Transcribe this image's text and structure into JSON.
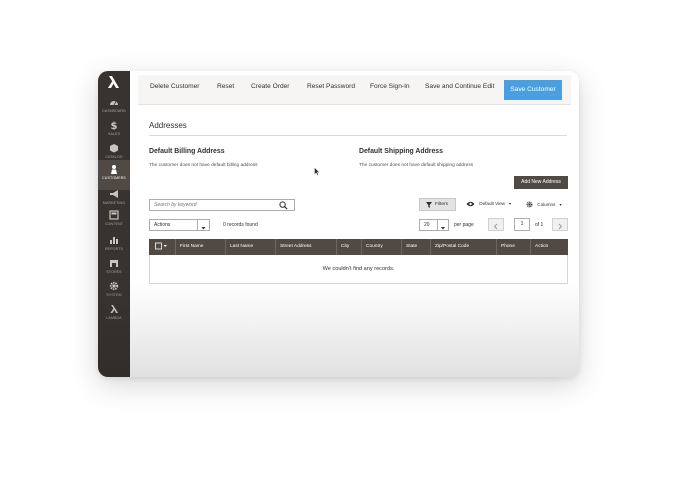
{
  "sidebar": {
    "items": [
      {
        "label": "Dashboard",
        "icon": "dashboard-icon"
      },
      {
        "label": "Sales",
        "icon": "dollar-icon"
      },
      {
        "label": "Catalog",
        "icon": "box-icon"
      },
      {
        "label": "Customers",
        "icon": "person-icon",
        "active": true
      },
      {
        "label": "Marketing",
        "icon": "megaphone-icon"
      },
      {
        "label": "Content",
        "icon": "layout-icon"
      },
      {
        "label": "Reports",
        "icon": "bar-chart-icon"
      },
      {
        "label": "Stores",
        "icon": "store-icon"
      },
      {
        "label": "System",
        "icon": "gear-icon"
      },
      {
        "label": "Lambda",
        "icon": "lambda-icon"
      }
    ]
  },
  "toolbar": {
    "delete_customer": "Delete Customer",
    "reset": "Reset",
    "create_order": "Create Order",
    "reset_password": "Reset Password",
    "force_sign_in": "Force Sign-In",
    "save_continue": "Save and Continue Edit",
    "save_customer": "Save Customer"
  },
  "addresses": {
    "title": "Addresses",
    "billing_title": "Default Billing Address",
    "billing_text": "The customer does not have default billing address",
    "shipping_title": "Default Shipping Address",
    "shipping_text": "The customer does not have default shipping address",
    "add_new": "Add New Address"
  },
  "grid": {
    "search_placeholder": "Search by keyword",
    "filters": "Filters",
    "default_view": "Default View",
    "columns_label": "Columns",
    "actions": "Actions",
    "records_found": "0 records found",
    "per_page_value": "20",
    "per_page_label": "per page",
    "page": "1",
    "of_pages": "of 1",
    "columns": [
      "First Name",
      "Last Name",
      "Street Address",
      "City",
      "Country",
      "State",
      "Zip/Postal Code",
      "Phone",
      "Action"
    ],
    "empty": "We couldn't find any records."
  },
  "colors": {
    "sidebar": "#373330",
    "sidebar_active": "#514943",
    "primary_button": "#4a9fe0",
    "grid_header": "#514943"
  }
}
